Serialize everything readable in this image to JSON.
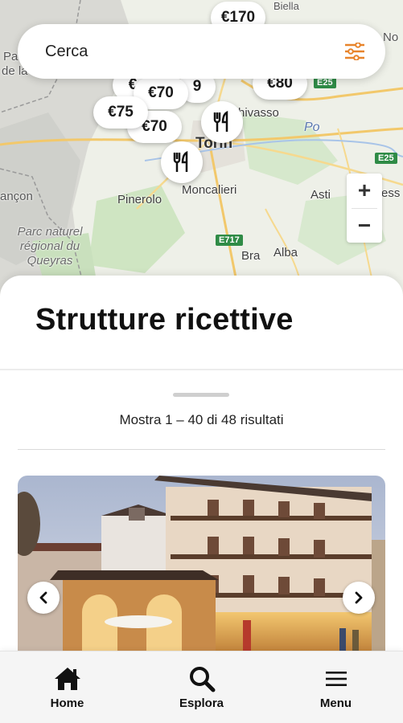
{
  "search": {
    "placeholder": "Cerca",
    "filter_icon": "sliders-icon"
  },
  "map": {
    "labels": {
      "pa": "Pa",
      "de_la": "de la",
      "no": "No",
      "biella": "Biella",
      "chivasso": "hivasso",
      "po": "Po",
      "torino": "Torin",
      "moncalieri": "Moncalieri",
      "asti": "Asti",
      "ess": "ess",
      "briancon": "ançon",
      "pinerolo": "Pinerolo",
      "parc": "Parc naturel régional du Queyras",
      "bra": "Bra",
      "alba": "Alba"
    },
    "roads": {
      "e717": "E717",
      "e25a": "E25",
      "e25b": "E25"
    },
    "pins": {
      "p170": "€170",
      "p80": "€80",
      "p70a": "€70",
      "p75": "€75",
      "p70b": "€70",
      "p_partial1": "€",
      "p_partial2": "9"
    },
    "zoom": {
      "in": "+",
      "out": "−"
    }
  },
  "sheet": {
    "title": "Strutture ricettive",
    "results": "Mostra 1 – 40 di 48 risultati"
  },
  "nav": {
    "home": "Home",
    "explore": "Esplora",
    "menu": "Menu"
  },
  "colors": {
    "accent": "#e8842b",
    "road_green": "#2f8b46"
  }
}
